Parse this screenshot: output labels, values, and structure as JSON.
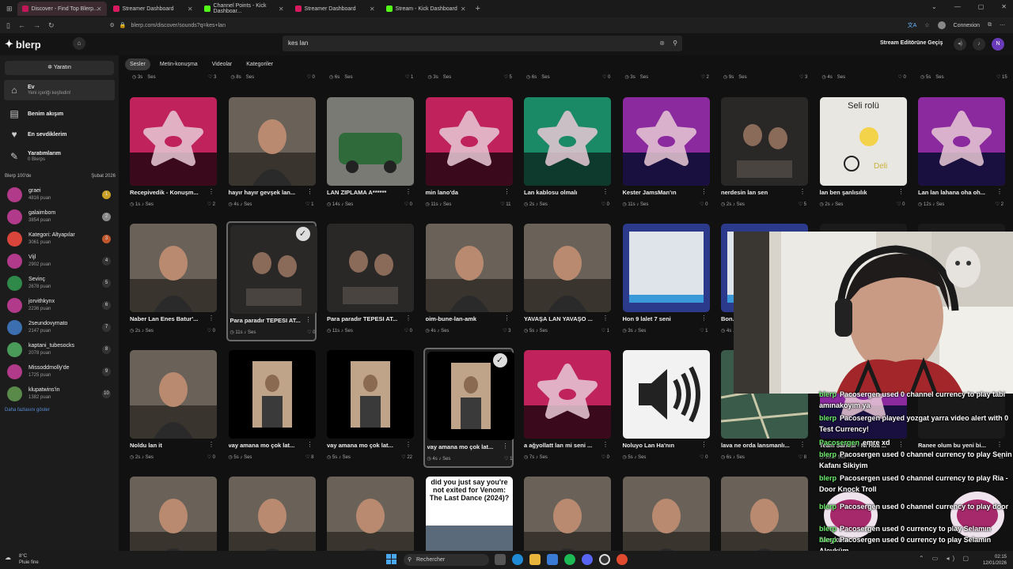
{
  "browser": {
    "tabs": [
      {
        "label": "Discover - Find Top Blerp...",
        "color": "#c2185b",
        "active": true
      },
      {
        "label": "Streamer Dashboard",
        "color": "#d81b60",
        "active": false
      },
      {
        "label": "Channel Points - Kick Dashboar...",
        "color": "#53fc18",
        "active": false
      },
      {
        "label": "Streamer Dashboard",
        "color": "#d81b60",
        "active": false
      },
      {
        "label": "Stream - Kick Dashboard",
        "color": "#53fc18",
        "active": false
      }
    ],
    "url": "blerp.com/discover/sounds?q=kes+lan",
    "connexion": "Connexion"
  },
  "header": {
    "logo": "blerp",
    "search_value": "kes lan",
    "studio_label": "Stream Editörüne Geçiş"
  },
  "sidebar": {
    "create_label": "Yaratın",
    "nav": [
      {
        "label": "Ev",
        "sub": "Yeni içeriği keşfedin!",
        "icon": "home-icon",
        "active": true
      },
      {
        "label": "Benim akışım",
        "sub": "",
        "icon": "feed-icon",
        "active": false
      },
      {
        "label": "En sevdiklerim",
        "sub": "",
        "icon": "heart-icon",
        "active": false
      },
      {
        "label": "Yaratımlarım",
        "sub": "0 Blerps",
        "icon": "tools-icon",
        "active": false
      }
    ],
    "leaderboard_title": "Blerp 100'de",
    "leaderboard_date": "Şubat 2026",
    "leaderboard": [
      {
        "name": "graei",
        "points": "4816 puan",
        "rank": "1",
        "color": "#b23a8a",
        "rankcolor": "#c9a227"
      },
      {
        "name": "galaimbom",
        "points": "3854 puan",
        "rank": "2",
        "color": "#b23a8a",
        "rankcolor": "#888"
      },
      {
        "name": "Kategori: Altyapılar",
        "points": "3061 puan",
        "rank": "3",
        "color": "#d8453b",
        "rankcolor": "#c0562b"
      },
      {
        "name": "Vijl",
        "points": "2902 puan",
        "rank": "4",
        "color": "#b23a8a",
        "rankcolor": "#333"
      },
      {
        "name": "Sevinç",
        "points": "2678 puan",
        "rank": "5",
        "color": "#2f8a4a",
        "rankcolor": "#333"
      },
      {
        "name": "jorvithkynx",
        "points": "2236 puan",
        "rank": "6",
        "color": "#b23a8a",
        "rankcolor": "#333"
      },
      {
        "name": "2seundovymato",
        "points": "2147 puan",
        "rank": "7",
        "color": "#3b6fb0",
        "rankcolor": "#333"
      },
      {
        "name": "kaptani_tubesocks",
        "points": "2078 puan",
        "rank": "8",
        "color": "#4a9a5a",
        "rankcolor": "#333"
      },
      {
        "name": "Missoddmolly'de",
        "points": "1725 puan",
        "rank": "9",
        "color": "#b23a8a",
        "rankcolor": "#333"
      },
      {
        "name": "klupatwins'in",
        "points": "1382 puan",
        "rank": "10",
        "color": "#5a8a4a",
        "rankcolor": "#333"
      }
    ],
    "show_more": "Daha fazlasını göster"
  },
  "filters": [
    "Sesler",
    "Metin-konuşma",
    "Videolar",
    "Kategoriler"
  ],
  "prev_row": [
    {
      "dur": "3s",
      "likes": "3"
    },
    {
      "dur": "8s",
      "likes": "0"
    },
    {
      "dur": "6s",
      "likes": "1"
    },
    {
      "dur": "3s",
      "likes": "5"
    },
    {
      "dur": "6s",
      "likes": "0"
    },
    {
      "dur": "3s",
      "likes": "2"
    },
    {
      "dur": "9s",
      "likes": "3"
    },
    {
      "dur": "4s",
      "likes": "0"
    },
    {
      "dur": "5s",
      "likes": "15"
    }
  ],
  "sound_label": "Ses",
  "cards": [
    {
      "title": "Recepivedik - Konuşm...",
      "dur": "1s",
      "likes": "2",
      "thumb": "pink",
      "sel": false
    },
    {
      "title": "hayır hayır gevşek lan...",
      "dur": "4s",
      "likes": "1",
      "thumb": "photo",
      "sel": false
    },
    {
      "title": "LAN ZIPLAMA A******",
      "dur": "14s",
      "likes": "0",
      "thumb": "car",
      "sel": false
    },
    {
      "title": "min lano'da",
      "dur": "11s",
      "likes": "11",
      "thumb": "pink",
      "sel": false
    },
    {
      "title": "Lan kablosu olmalı",
      "dur": "2s",
      "likes": "0",
      "thumb": "green",
      "sel": false
    },
    {
      "title": "Kester JamsMan'ın",
      "dur": "11s",
      "likes": "0",
      "thumb": "synth",
      "sel": false
    },
    {
      "title": "nerdesin lan sen",
      "dur": "2s",
      "likes": "5",
      "thumb": "dark",
      "sel": false
    },
    {
      "title": "lan ben şanlısılık",
      "dur": "2s",
      "likes": "0",
      "thumb": "white",
      "sel": false
    },
    {
      "title": "Lan lan lahana oha oh...",
      "dur": "12s",
      "likes": "2",
      "thumb": "synth",
      "sel": false
    },
    {
      "title": "Naber Lan Enes Batur'...",
      "dur": "2s",
      "likes": "0",
      "thumb": "photo",
      "sel": false
    },
    {
      "title": "Para paradır TEPESI AT...",
      "dur": "11s",
      "likes": "0",
      "thumb": "dark",
      "sel": true
    },
    {
      "title": "Para paradır TEPESI AT...",
      "dur": "11s",
      "likes": "0",
      "thumb": "dark",
      "sel": false
    },
    {
      "title": "oim-bune-lan-amk",
      "dur": "4s",
      "likes": "3",
      "thumb": "photo",
      "sel": false
    },
    {
      "title": "YAVAŞA LAN YAVAŞO ...",
      "dur": "5s",
      "likes": "1",
      "thumb": "photo",
      "sel": false
    },
    {
      "title": "Hon 9 lalet 7 seni",
      "dur": "3s",
      "likes": "1",
      "thumb": "screen",
      "sel": false
    },
    {
      "title": "Bon...",
      "dur": "4s",
      "likes": "",
      "thumb": "screen",
      "sel": false
    },
    {
      "title": "",
      "dur": "",
      "likes": "",
      "thumb": "none",
      "sel": false
    },
    {
      "title": "",
      "dur": "",
      "likes": "",
      "thumb": "none",
      "sel": false
    },
    {
      "title": "Noldu lan it",
      "dur": "2s",
      "likes": "0",
      "thumb": "photo",
      "sel": false
    },
    {
      "title": "vay amana mo çok lat...",
      "dur": "5s",
      "likes": "8",
      "thumb": "portrait",
      "sel": false
    },
    {
      "title": "vay amana mo çok lat...",
      "dur": "5s",
      "likes": "22",
      "thumb": "portrait",
      "sel": false
    },
    {
      "title": "vay amana mo çok lat...",
      "dur": "4s",
      "likes": "1",
      "thumb": "portrait",
      "sel": true
    },
    {
      "title": "a ağyollatt lan mi seni ...",
      "dur": "7s",
      "likes": "0",
      "thumb": "pink",
      "sel": false
    },
    {
      "title": "Noluyo Lan Ha'nın",
      "dur": "5s",
      "likes": "0",
      "thumb": "speaker",
      "sel": false
    },
    {
      "title": "lava ne orda lansmanlı...",
      "dur": "6s",
      "likes": "8",
      "thumb": "map",
      "sel": false
    },
    {
      "title": "Team Sarkisi - Ni Hoa ...",
      "dur": "13s",
      "likes": "",
      "thumb": "synth",
      "sel": false
    },
    {
      "title": "Ranee olum bu yeni bi...",
      "dur": "",
      "likes": "11",
      "thumb": "none",
      "sel": false
    },
    {
      "title": "",
      "dur": "",
      "likes": "",
      "thumb": "photo",
      "sel": false
    },
    {
      "title": "",
      "dur": "",
      "likes": "",
      "thumb": "photo",
      "sel": false
    },
    {
      "title": "",
      "dur": "",
      "likes": "",
      "thumb": "photo",
      "sel": false
    },
    {
      "title": "",
      "dur": "",
      "likes": "",
      "thumb": "meme",
      "sel": false
    },
    {
      "title": "",
      "dur": "",
      "likes": "",
      "thumb": "photo",
      "sel": false
    },
    {
      "title": "",
      "dur": "",
      "likes": "",
      "thumb": "photo",
      "sel": false
    },
    {
      "title": "",
      "dur": "",
      "likes": "",
      "thumb": "photo",
      "sel": false
    }
  ],
  "meme_text": "did you just say you're not exited for Venom: The Last Dance (2024)?",
  "white_text": {
    "top": "Seli rolü",
    "bottom": "Deli"
  },
  "chat": [
    {
      "user": "blerp",
      "text": "Pacosergen used 0 channel currency to play tabi amınakoyım ya"
    },
    {
      "user": "blerp",
      "text": "Pacosergen played yozgat yarra video alert with 0 Test Currency!"
    },
    {
      "user": "Pacosergen",
      "text": "emre xd"
    },
    {
      "user": "blerp",
      "text": "Pacosergen used 0 channel currency to play Senin Kafanı Sikiyim"
    },
    {
      "user": "blerp",
      "text": "Pacosergen used 0 channel currency to play Ria - Door Knock Troll"
    },
    {
      "user": "blerp",
      "text": "Pacosergen used 0 channel currency to play door"
    },
    {
      "user": "blerp",
      "text": "Pacosergen used 0 currency to play Selamın Aleyküm"
    },
    {
      "user": "blerp",
      "text": "Pacosergen used 0 currency to play Selamın Aleyküm"
    }
  ],
  "taskbar": {
    "weather_temp": "8°C",
    "weather_desc": "Pluie fine",
    "search": "Rechercher",
    "time": "02:15",
    "date": "12/01/2026"
  }
}
